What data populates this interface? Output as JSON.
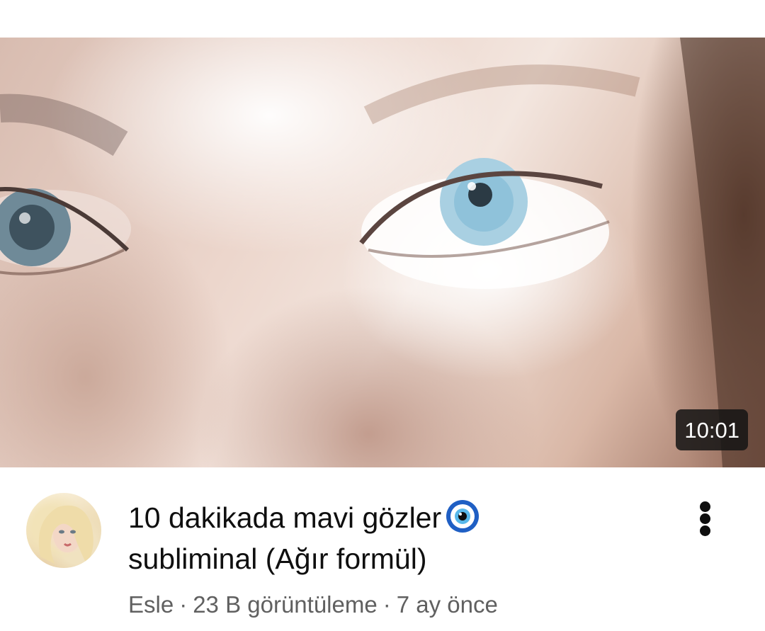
{
  "video": {
    "title": "10 dakikada mavi gözler",
    "title_line2": "subliminal (Ağır formül)",
    "title_emoji_icon": "nazar-boncugu-icon",
    "duration": "10:01",
    "channel": "Esle",
    "separator": "·",
    "views": "23 B görüntüleme",
    "age": "7 ay önce"
  },
  "icons": {
    "more": "more-vertical-icon"
  },
  "colors": {
    "title": "#0f0f0f",
    "meta": "#606060",
    "duration_bg": "#141414",
    "duration_text": "#ffffff"
  }
}
